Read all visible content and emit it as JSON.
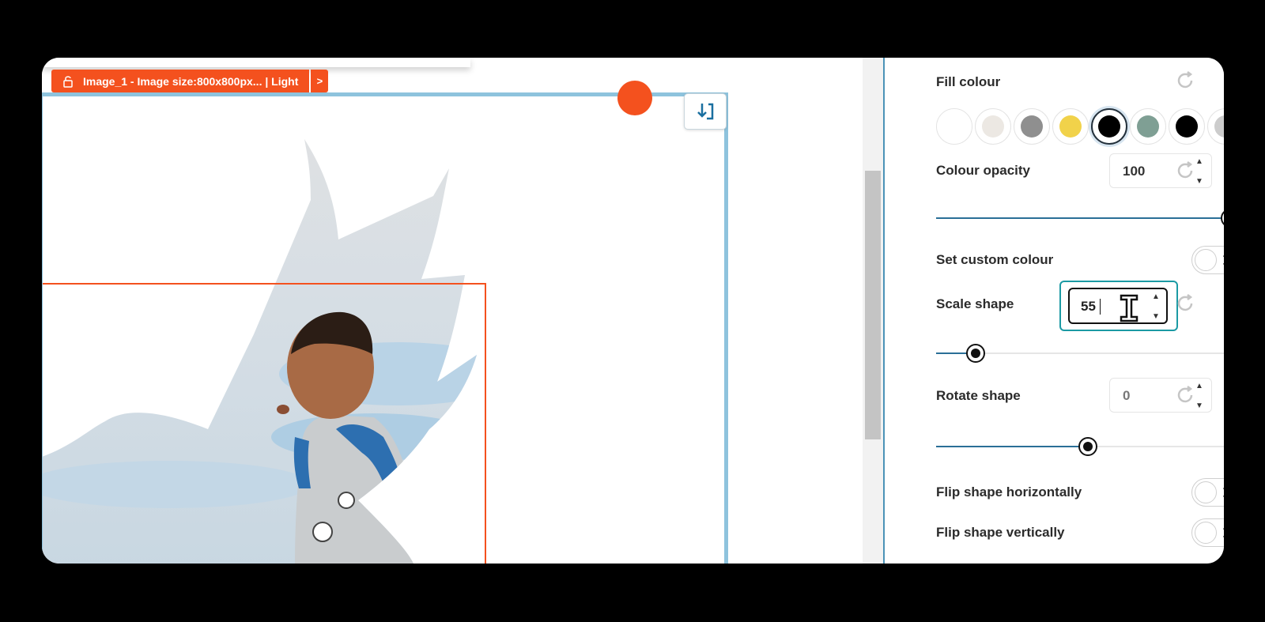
{
  "layer_tag": {
    "text": "Image_1 - Image size:800x800px...  | Light",
    "next": ">"
  },
  "fill_colour": {
    "label": "Fill colour",
    "swatches": [
      "#ffffff",
      "#ece8e3",
      "#8f8f8f",
      "#f1d24a",
      "#000000",
      "#7f9f94",
      "#000000",
      "#cccccc"
    ],
    "selected_index": 4
  },
  "colour_opacity": {
    "label": "Colour opacity",
    "value": "100",
    "slider_percent": 100
  },
  "custom_colour": {
    "label": "Set custom colour",
    "on": false
  },
  "scale_shape": {
    "label": "Scale shape",
    "value": "55",
    "slider_percent": 13
  },
  "rotate_shape": {
    "label": "Rotate shape",
    "value": "0",
    "slider_percent": 50
  },
  "flip_h": {
    "label": "Flip shape horizontally",
    "on": false
  },
  "flip_v": {
    "label": "Flip shape vertically",
    "on": false
  },
  "colors": {
    "accent": "#f4511e",
    "frame": "#8ec3dd",
    "focus": "#1b9aa4",
    "slider": "#2a6f97"
  },
  "icons": {
    "spin_up": "▲",
    "spin_down": "▼",
    "toggle_off": "✕"
  }
}
